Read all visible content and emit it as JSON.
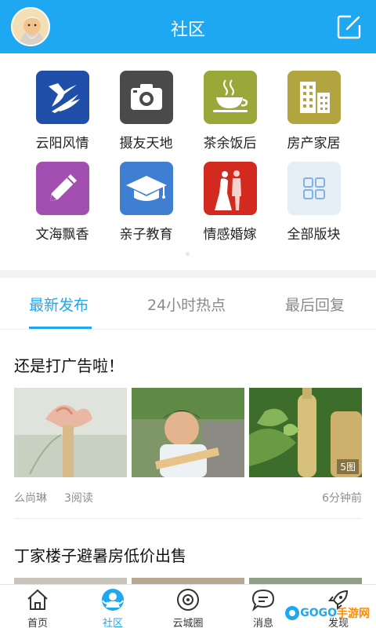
{
  "header": {
    "title": "社区"
  },
  "categories": [
    {
      "label": "云阳风情",
      "color": "#1f4fa8",
      "icon": "yunyang-logo-icon"
    },
    {
      "label": "摄友天地",
      "color": "#4a4a4a",
      "icon": "camera-icon"
    },
    {
      "label": "茶余饭后",
      "color": "#9aa83a",
      "icon": "coffee-cup-icon"
    },
    {
      "label": "房产家居",
      "color": "#b2a43f",
      "icon": "building-icon"
    },
    {
      "label": "文海飘香",
      "color": "#a24fb1",
      "icon": "pencil-icon"
    },
    {
      "label": "亲子教育",
      "color": "#3f7fd1",
      "icon": "graduation-cap-icon"
    },
    {
      "label": "情感婚嫁",
      "color": "#d32a1f",
      "icon": "couple-icon"
    },
    {
      "label": "全部版块",
      "color": "#e6eef6",
      "icon": "grid-icon"
    }
  ],
  "tabs": [
    {
      "label": "最新发布",
      "active": true
    },
    {
      "label": "24小时热点",
      "active": false
    },
    {
      "label": "最后回复",
      "active": false
    }
  ],
  "posts": [
    {
      "title": "还是打广告啦！",
      "author": "么尚琳",
      "reads": "3阅读",
      "time": "6分钟前",
      "image_count": "5图"
    },
    {
      "title": "丁家楼子避暑房低价出售"
    }
  ],
  "nav": [
    {
      "label": "首页",
      "icon": "home-icon",
      "active": false
    },
    {
      "label": "社区",
      "icon": "community-icon",
      "active": true
    },
    {
      "label": "云城圈",
      "icon": "circle-eye-icon",
      "active": false
    },
    {
      "label": "消息",
      "icon": "chat-icon",
      "active": false
    },
    {
      "label": "发现",
      "icon": "rocket-icon",
      "active": false
    }
  ],
  "watermark": {
    "part1": "GOGO",
    "part2": "手游网"
  },
  "colors": {
    "accent": "#1fa8f2"
  }
}
